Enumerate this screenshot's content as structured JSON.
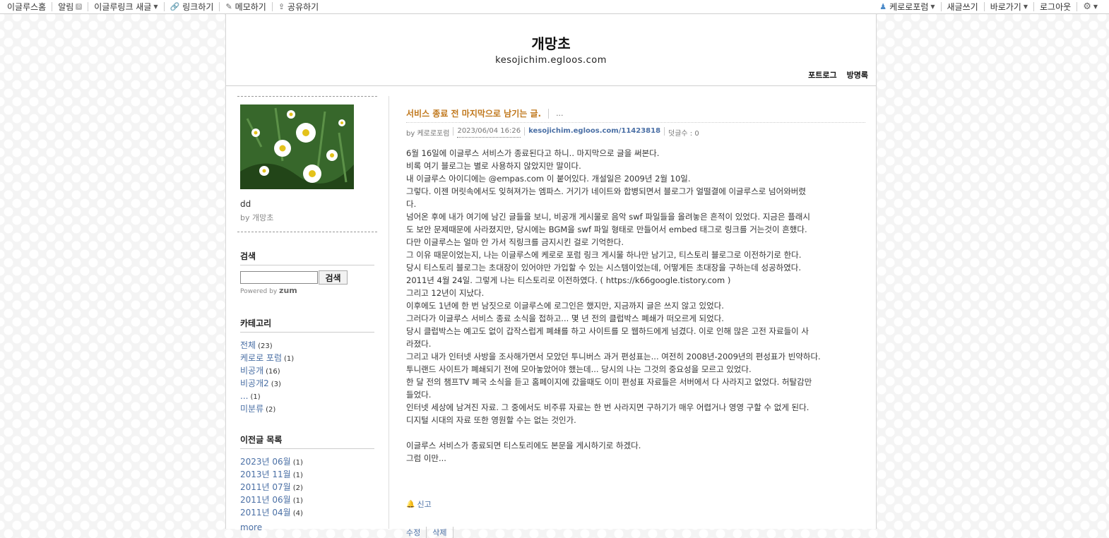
{
  "topbar": {
    "left": [
      "이글루스홈",
      "알림",
      "이글루링크 새글",
      "링크하기",
      "메모하기",
      "공유하기"
    ],
    "right": [
      "케로로포럼",
      "새글쓰기",
      "바로가기",
      "로그아웃"
    ]
  },
  "blog": {
    "title": "개망초",
    "url": "kesojichim.egloos.com",
    "links": [
      "포트로그",
      "방명록"
    ]
  },
  "profile": {
    "name": "dd",
    "by": "by 개망초"
  },
  "search": {
    "title": "검색",
    "button": "검색",
    "powered": "Powered by",
    "powered_brand": "zum",
    "value": ""
  },
  "categories": {
    "title": "카테고리",
    "items": [
      {
        "label": "전체",
        "count": "(23)"
      },
      {
        "label": "케로로 포럼",
        "count": "(1)"
      },
      {
        "label": "비공개",
        "count": "(16)"
      },
      {
        "label": "비공개2",
        "count": "(3)"
      },
      {
        "label": "...",
        "count": "(1)"
      },
      {
        "label": "미분류",
        "count": "(2)"
      }
    ]
  },
  "archive": {
    "title": "이전글 목록",
    "items": [
      {
        "label": "2023년 06월",
        "count": "(1)"
      },
      {
        "label": "2013년 11월",
        "count": "(1)"
      },
      {
        "label": "2011년 07월",
        "count": "(2)"
      },
      {
        "label": "2011년 06월",
        "count": "(1)"
      },
      {
        "label": "2011년 04월",
        "count": "(4)"
      }
    ],
    "more": "more"
  },
  "post": {
    "title": "서비스 종료 전 마지막으로 남기는 글.",
    "category": "...",
    "by": "by 케로로포럼",
    "date": "2023/06/04 16:26",
    "link": "kesojichim.egloos.com/11423818",
    "comments": "덧글수 : 0",
    "lines": [
      "6월 16일에 이글루스 서비스가 종료된다고 하니.. 마지막으로 글을 써본다.",
      "비록 여기 블로그는 별로 사용하지 않았지만 말이다.",
      "내 이글루스 아이디에는 @empas.com 이 붙어있다. 개설일은 2009년 2월 10일.",
      "그렇다. 이젠 머릿속에서도 잊혀져가는 엠파스. 거기가 네이트와 합병되면서 블로그가 얼떨결에 이글루스로 넘어와버렸",
      "다.",
      "넘어온 후에 내가 여기에 남긴 글들을 보니, 비공개 게시물로 음악 swf 파일들을 올려놓은 흔적이 있었다. 지금은 플래시",
      "도 보안 문제때문에 사라졌지만, 당시에는 BGM을 swf 파일 형태로 만들어서 embed 태그로 링크를 거는것이 흔했다.",
      "다만 이글루스는 얼마 안 가서 직링크를 금지시킨 걸로 기억한다.",
      "그 이유 때문이었는지, 나는 이글루스에 케로로 포럼 링크 게시물 하나만 남기고, 티스토리 블로그로 이전하기로 한다.",
      "당시 티스토리 블로그는 초대장이 있어야만 가입할 수 있는 시스템이었는데, 어떻게든 초대장을 구하는데 성공하였다.",
      "2011년 4월 24일. 그렇게 나는 티스토리로 이전하였다. ( https://k66google.tistory.com )",
      "그리고 12년이 지났다.",
      "이후에도 1년에 한 번 남짓으로 이글루스에 로그인은 했지만, 지금까지 글은 쓰지 않고 있었다.",
      "그러다가 이글루스 서비스 종료 소식을 접하고... 몇 년 전의 클럽박스 폐쇄가 떠오르게 되었다.",
      "당시 클럽박스는 예고도 없이 갑작스럽게 폐쇄를 하고 사이트를 모 웹하드에게 넘겼다. 이로 인해 많은 고전 자료들이 사",
      "라졌다.",
      "그리고 내가 인터넷 사방을 조사해가면서 모았던 투니버스 과거 편성표는... 여전히 2008년-2009년의 편성표가 빈약하다.",
      "투니랜드 사이트가 폐쇄되기 전에 모아놓았어야 했는데... 당시의 나는 그것의 중요성을 모르고 있었다.",
      "한 달 전의 챔프TV 폐국 소식을 듣고 홈페이지에 갔을때도 이미 편성표 자료들은 서버에서 다 사라지고 없었다. 허탈감만",
      "들었다.",
      "인터넷 세상에 남겨진 자료. 그 중에서도 비주류 자료는 한 번 사라지면 구하기가 매우 어렵거나 영영 구할 수 없게 된다.",
      "디지털 시대의 자료 또한 영원할 수는 없는 것인가.",
      "",
      "이글루스 서비스가 종료되면 티스토리에도 본문을 게시하기로 하겠다.",
      "그럼 이만..."
    ],
    "report": "신고",
    "actions": [
      "수정",
      "삭제"
    ]
  },
  "colors": {
    "accent_title": "#c0771b",
    "link": "#4a6fa5"
  }
}
